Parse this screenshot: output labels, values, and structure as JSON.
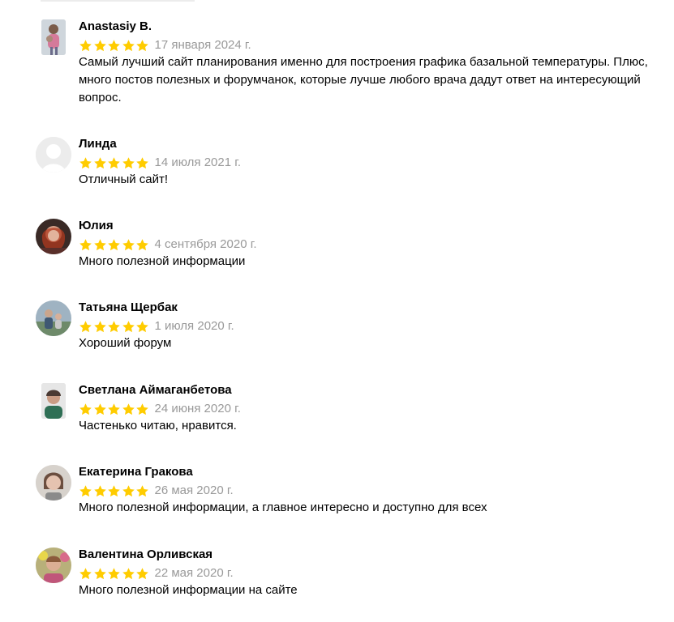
{
  "reviews": [
    {
      "author": "Anastasiy B.",
      "rating": 5,
      "date": "17 января 2024 г.",
      "text": "Самый лучший сайт планирования именно для построения графика базальной температуры. Плюс, много постов полезных и форумчанок, которые лучше любого врача дадут ответ на интересующий вопрос.",
      "avatar": "photo-woman-with-child"
    },
    {
      "author": "Линда",
      "rating": 5,
      "date": "14 июля 2021 г.",
      "text": "Отличный сайт!",
      "avatar": "default-user-icon"
    },
    {
      "author": "Юлия",
      "rating": 5,
      "date": "4 сентября 2020 г.",
      "text": "Много полезной информации",
      "avatar": "photo-red-hair"
    },
    {
      "author": "Татьяна Щербак",
      "rating": 5,
      "date": "1 июля 2020 г.",
      "text": "Хороший форум",
      "avatar": "photo-family"
    },
    {
      "author": "Светлана Аймаганбетова",
      "rating": 5,
      "date": "24 июня 2020 г.",
      "text": "Частенько читаю, нравится.",
      "avatar": "photo-portrait"
    },
    {
      "author": "Екатерина Гракова",
      "rating": 5,
      "date": "26 мая 2020 г.",
      "text": "Много полезной информации, а главное интересно и доступно для всех",
      "avatar": "photo-woman"
    },
    {
      "author": "Валентина Орливская",
      "rating": 5,
      "date": "22 мая 2020 г.",
      "text": "Много полезной информации на сайте",
      "avatar": "photo-woman-flowers"
    }
  ],
  "colors": {
    "star": "#ffcc00",
    "date": "#999999",
    "text": "#000000"
  }
}
